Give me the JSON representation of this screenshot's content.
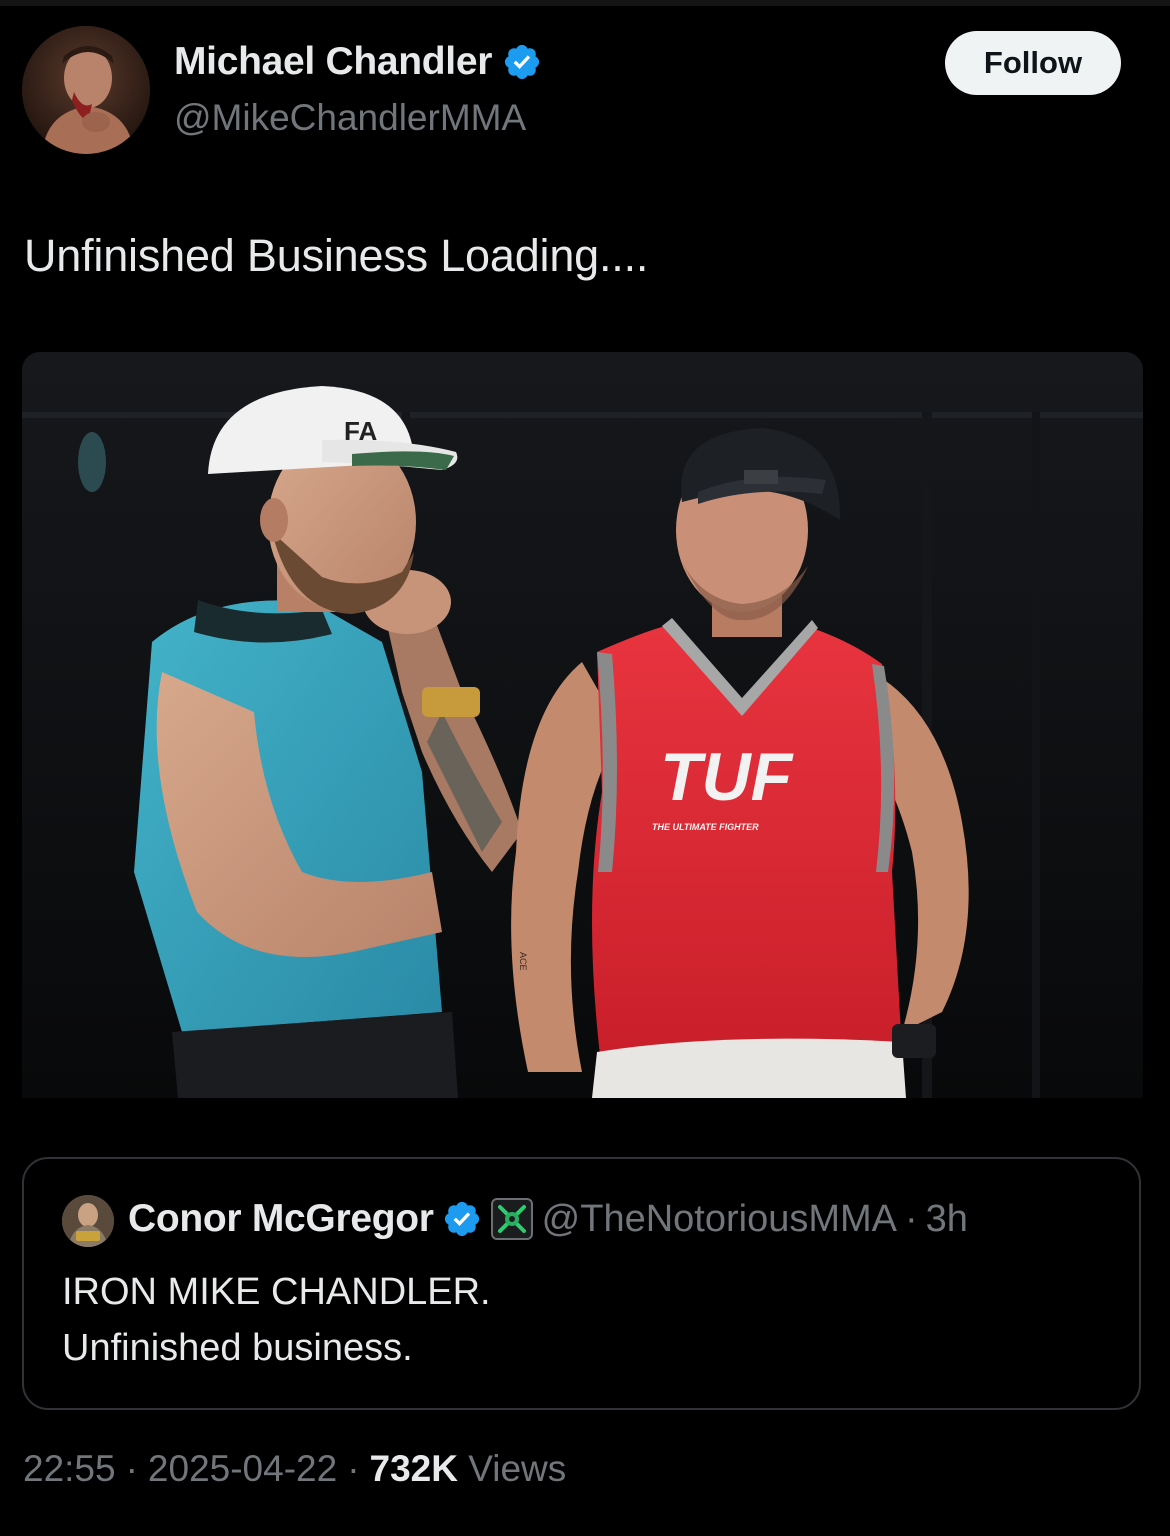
{
  "author": {
    "name": "Michael Chandler",
    "handle": "@MikeChandlerMMA"
  },
  "follow_label": "Follow",
  "tweet": {
    "text": "Unfinished Business Loading...."
  },
  "media": {
    "cap_text": "FA",
    "shirt_logo": "TUF",
    "shirt_subtitle": "THE ULTIMATE FIGHTER",
    "arm_tattoo": "ACE"
  },
  "quote": {
    "name": "Conor McGregor",
    "handle": "@TheNotoriousMMA",
    "separator": "·",
    "time": "3h",
    "line1": "IRON MIKE CHANDLER.",
    "line2": "Unfinished business."
  },
  "meta": {
    "time": "22:55",
    "dot1": "·",
    "date": "2025-04-22",
    "dot2": "·",
    "views_count": "732K",
    "views_label": "Views"
  },
  "colors": {
    "background": "#000000",
    "text_primary": "#e7e9ea",
    "text_secondary": "#71767b",
    "verified_blue": "#1d9bf0",
    "border": "#2f3336",
    "follow_bg": "#eff3f4"
  }
}
